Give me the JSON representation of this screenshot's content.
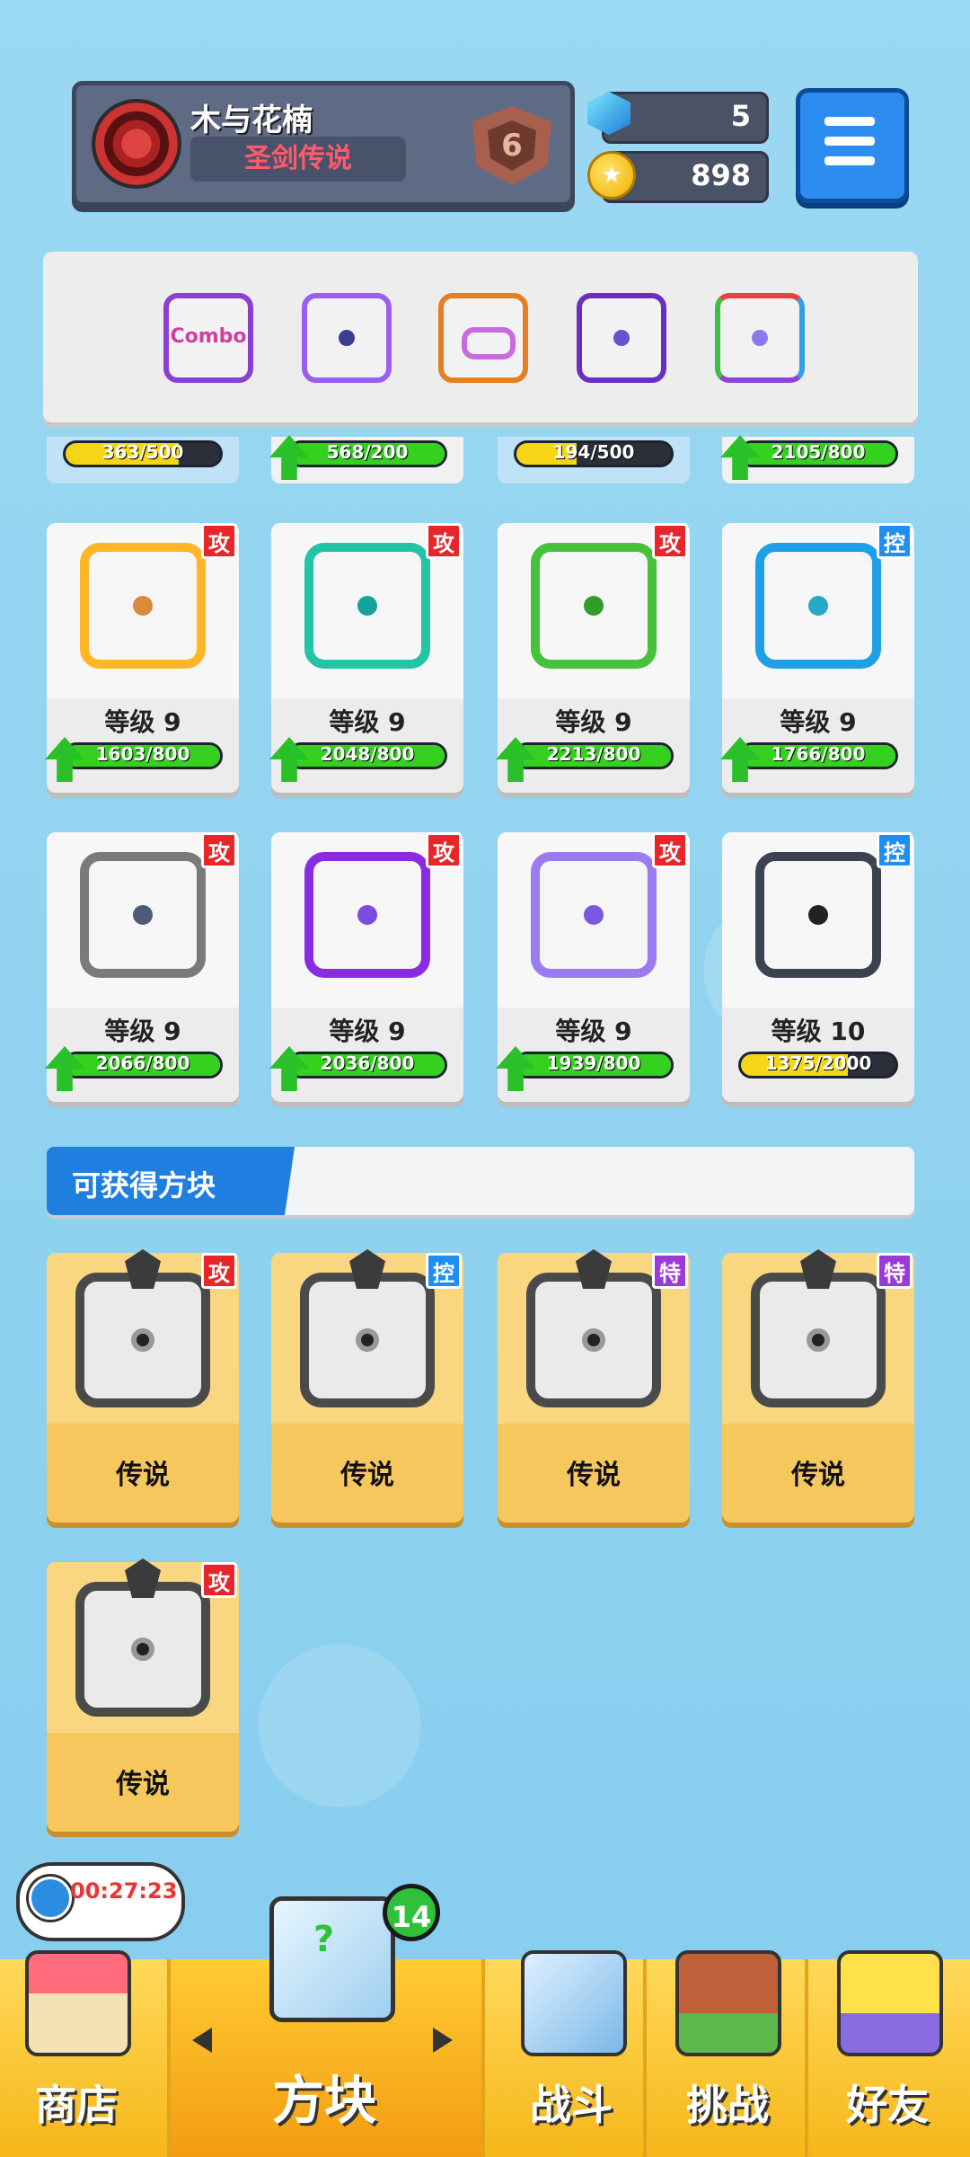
{
  "header": {
    "player_name": "木与花楠",
    "player_title": "圣剑传说",
    "rank": "6",
    "gems": "5",
    "coins": "898",
    "icons": {
      "emblem": "clan-emblem-icon",
      "gem": "gem-icon",
      "coin": "coin-icon",
      "menu": "menu-icon"
    }
  },
  "deck": {
    "slots": [
      "combo-dice",
      "lightning-dice",
      "infinity-dice",
      "dragon-eye-dice",
      "rainbow-dice"
    ],
    "combo_text": "Combo"
  },
  "partial_row": [
    {
      "progress": "363/500",
      "fill": 0.73,
      "upgradable": false,
      "bar": "yellow"
    },
    {
      "progress": "568/200",
      "fill": 1.0,
      "upgradable": true,
      "bar": "green"
    },
    {
      "progress": "194/500",
      "fill": 0.39,
      "upgradable": false,
      "bar": "yellow"
    },
    {
      "progress": "2105/800",
      "fill": 1.0,
      "upgradable": true,
      "bar": "green"
    }
  ],
  "dice_rows": [
    [
      {
        "name": "electric-dice",
        "color": "#ffb627",
        "pip": "#d98a3a",
        "tag": "攻",
        "tag_type": "atk",
        "level": "等级 9",
        "progress": "1603/800",
        "fill": 1.0,
        "upgradable": true
      },
      {
        "name": "wind-dice",
        "color": "#23c4a6",
        "pip": "#14a39b",
        "tag": "攻",
        "tag_type": "atk",
        "level": "等级 9",
        "progress": "2048/800",
        "fill": 1.0,
        "upgradable": true
      },
      {
        "name": "poison-dice",
        "color": "#46c23a",
        "pip": "#2f9e2a",
        "tag": "攻",
        "tag_type": "atk",
        "level": "等级 9",
        "progress": "2213/800",
        "fill": 1.0,
        "upgradable": true
      },
      {
        "name": "ice-dice",
        "color": "#1ea0e8",
        "pip": "#27a8c9",
        "tag": "控",
        "tag_type": "ctl",
        "level": "等级 9",
        "progress": "1766/800",
        "fill": 1.0,
        "upgradable": true
      }
    ],
    [
      {
        "name": "iron-dice",
        "color": "#7a7a7a",
        "pip": "#4d5a7a",
        "tag": "攻",
        "tag_type": "atk",
        "level": "等级 9",
        "progress": "2066/800",
        "fill": 1.0,
        "upgradable": true
      },
      {
        "name": "teleport-dice",
        "color": "#8a2be2",
        "pip": "#7a4de0",
        "tag": "攻",
        "tag_type": "atk",
        "level": "等级 9",
        "progress": "2036/800",
        "fill": 1.0,
        "upgradable": true
      },
      {
        "name": "mystery-dice",
        "color": "#9b7bf0",
        "pip": "#7b58e0",
        "tag": "攻",
        "tag_type": "atk",
        "level": "等级 9",
        "progress": "1939/800",
        "fill": 1.0,
        "upgradable": true
      },
      {
        "name": "lock-dice",
        "color": "#3d4250",
        "pip": "#222222",
        "tag": "控",
        "tag_type": "ctl",
        "level": "等级 10",
        "progress": "1375/2000",
        "fill": 0.69,
        "upgradable": false
      }
    ]
  ],
  "obtainable": {
    "title": "可获得方块",
    "items": [
      {
        "name": "legend-gear-dice",
        "tag": "攻",
        "tag_type": "atk",
        "label": "传说"
      },
      {
        "name": "legend-shield-dice",
        "tag": "控",
        "tag_type": "ctl",
        "label": "传说"
      },
      {
        "name": "legend-pentagram-dice",
        "tag": "特",
        "tag_type": "spc",
        "label": "传说"
      },
      {
        "name": "legend-wing-dice",
        "tag": "特",
        "tag_type": "spc",
        "label": "传说"
      },
      {
        "name": "legend-vortex-dice",
        "tag": "攻",
        "tag_type": "atk",
        "label": "传说"
      }
    ]
  },
  "bottom_nav": {
    "timer": "00:27:23",
    "badge_count": "14",
    "tabs": [
      {
        "id": "shop",
        "label": "商店",
        "icon": "shop-icon"
      },
      {
        "id": "dice",
        "label": "方块",
        "icon": "dice-box-icon",
        "active": true
      },
      {
        "id": "battle",
        "label": "战斗",
        "icon": "sword-icon"
      },
      {
        "id": "challenge",
        "label": "挑战",
        "icon": "gate-icon"
      },
      {
        "id": "friends",
        "label": "好友",
        "icon": "friend-icon"
      }
    ]
  }
}
